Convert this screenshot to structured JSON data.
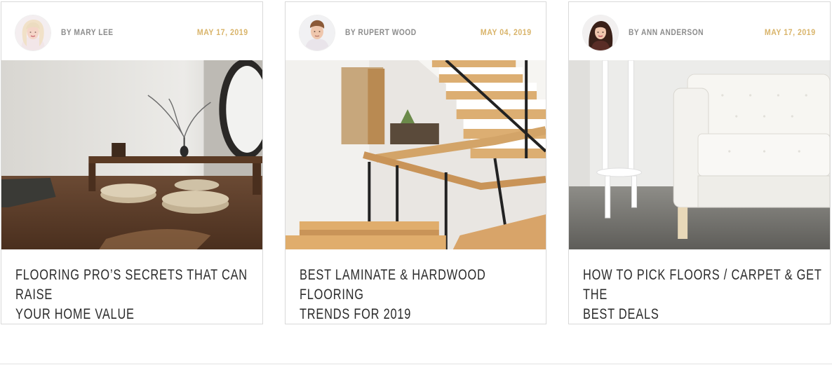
{
  "posts": [
    {
      "author": "BY MARY LEE",
      "date": "MAY 17, 2019",
      "title_line1": "FLOORING PRO’S SECRETS THAT CAN RAISE",
      "title_line2": "YOUR HOME VALUE",
      "avatar_icon": "avatar-blonde-woman",
      "photo_icon": "living-room-wood-floor-photo"
    },
    {
      "author": "BY RUPERT WOOD",
      "date": "MAY 04, 2019",
      "title_line1": "BEST LAMINATE & HARDWOOD FLOORING",
      "title_line2": "TRENDS FOR 2019",
      "avatar_icon": "avatar-young-man",
      "photo_icon": "wooden-staircase-photo"
    },
    {
      "author": "BY ANN ANDERSON",
      "date": "MAY 17, 2019",
      "title_line1": "HOW TO PICK FLOORS / CARPET & GET THE",
      "title_line2": "BEST DEALS",
      "avatar_icon": "avatar-brunette-woman",
      "photo_icon": "white-sofa-concrete-floor-photo"
    }
  ],
  "colors": {
    "date_accent": "#d9b46a",
    "author_gray": "#8c8c8c",
    "title_dark": "#2b2b2b",
    "border": "#d9d9d9"
  }
}
